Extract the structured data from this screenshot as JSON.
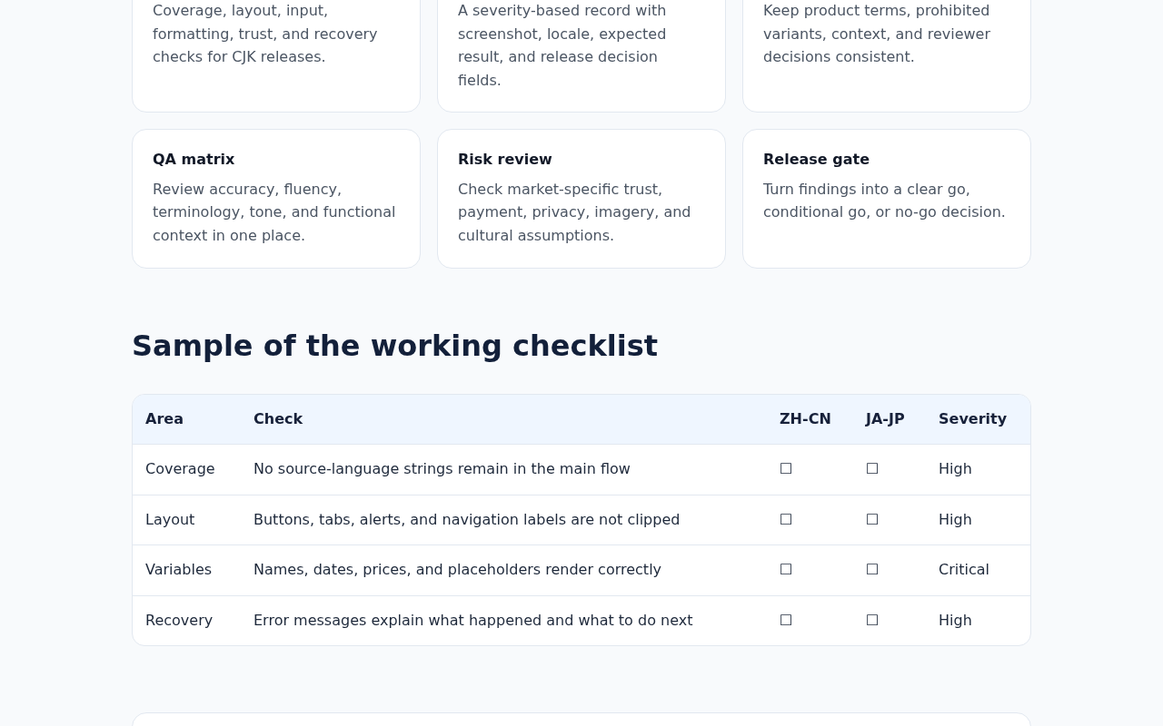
{
  "feature_cards": [
    {
      "description": "Coverage, layout, input, formatting, trust, and recovery checks for CJK releases."
    },
    {
      "description": "A severity-based record with screenshot, locale, expected result, and release decision fields."
    },
    {
      "description": "Keep product terms, prohibited variants, context, and reviewer decisions consistent."
    },
    {
      "title": "QA matrix",
      "description": "Review accuracy, fluency, terminology, tone, and functional context in one place."
    },
    {
      "title": "Risk review",
      "description": "Check market-specific trust, payment, privacy, imagery, and cultural assumptions."
    },
    {
      "title": "Release gate",
      "description": "Turn findings into a clear go, conditional go, or no-go decision."
    }
  ],
  "checklist": {
    "title": "Sample of the working checklist",
    "columns": [
      "Area",
      "Check",
      "ZH-CN",
      "JA-JP",
      "Severity"
    ],
    "rows": [
      [
        "Coverage",
        "No source-language strings remain in the main flow",
        "☐",
        "☐",
        "High"
      ],
      [
        "Layout",
        "Buttons, tabs, alerts, and navigation labels are not clipped",
        "☐",
        "☐",
        "High"
      ],
      [
        "Variables",
        "Names, dates, prices, and placeholders render correctly",
        "☐",
        "☐",
        "Critical"
      ],
      [
        "Recovery",
        "Error messages explain what happened and what to do next",
        "☐",
        "☐",
        "High"
      ]
    ]
  }
}
